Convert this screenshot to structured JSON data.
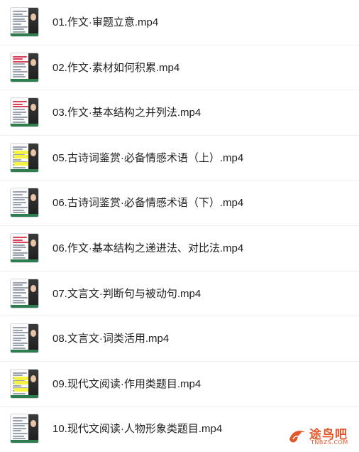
{
  "files": [
    {
      "name": "01.作文·审题立意.mp4",
      "thumb": "plain"
    },
    {
      "name": "02.作文·素材如何积累.mp4",
      "thumb": "red"
    },
    {
      "name": "03.作文·基本结构之并列法.mp4",
      "thumb": "red"
    },
    {
      "name": "05.古诗词鉴赏·必备情感术语（上）.mp4",
      "thumb": "yellow"
    },
    {
      "name": "06.古诗词鉴赏·必备情感术语（下）.mp4",
      "thumb": "plain"
    },
    {
      "name": "06.作文·基本结构之递进法、对比法.mp4",
      "thumb": "red"
    },
    {
      "name": "07.文言文·判断句与被动句.mp4",
      "thumb": "plain"
    },
    {
      "name": "08.文言文·词类活用.mp4",
      "thumb": "plain"
    },
    {
      "name": "09.现代文阅读·作用类题目.mp4",
      "thumb": "yellow"
    },
    {
      "name": "10.现代文阅读·人物形象类题目.mp4",
      "thumb": "plain"
    }
  ],
  "watermark": {
    "title": "途鸟吧",
    "subtitle": "TNBZS.COM"
  }
}
